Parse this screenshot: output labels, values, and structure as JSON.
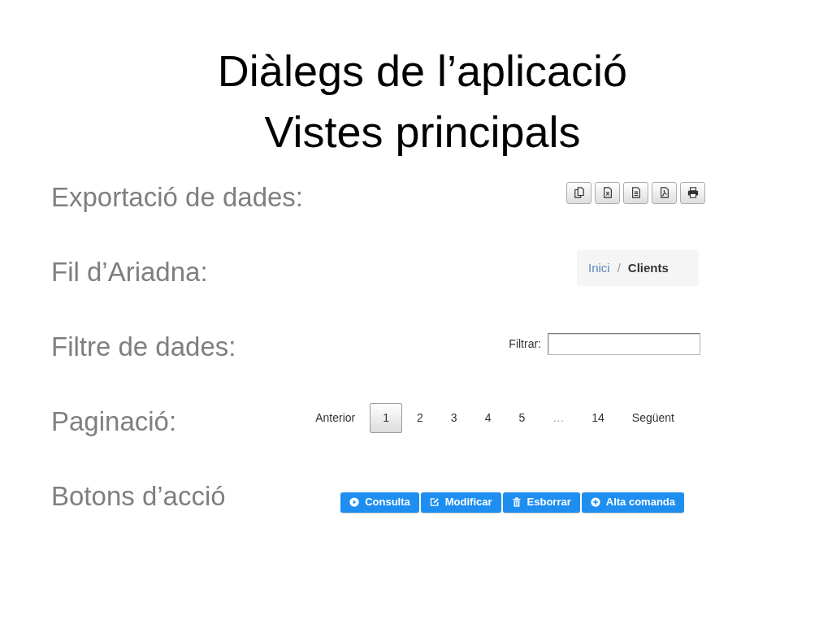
{
  "title_lines": [
    "Diàlegs de l’aplicació",
    "Vistes principals"
  ],
  "rows": [
    {
      "label": "Exportació de dades:",
      "kind": "export"
    },
    {
      "label": "Fil d’Ariadna:",
      "kind": "breadcrumb",
      "breadcrumb": {
        "separator": "/",
        "items": [
          {
            "label": "Inici",
            "selected": false
          },
          {
            "label": "Clients",
            "selected": true
          }
        ]
      }
    },
    {
      "label": "Filtre de dades:",
      "kind": "filter",
      "filter": {
        "label": "Filtrar:"
      }
    },
    {
      "label": "Paginació:",
      "kind": "pagination",
      "pages": [
        {
          "label": "Anterior",
          "kind": "page",
          "selected": false
        },
        {
          "label": "1",
          "kind": "page",
          "selected": true
        },
        {
          "label": "2",
          "kind": "page",
          "selected": false
        },
        {
          "label": "3",
          "kind": "page",
          "selected": false
        },
        {
          "label": "4",
          "kind": "page",
          "selected": false
        },
        {
          "label": "5",
          "kind": "page",
          "selected": false
        },
        {
          "label": "…",
          "kind": "ellipsis"
        },
        {
          "label": "14",
          "kind": "page",
          "selected": false
        },
        {
          "label": "Següent",
          "kind": "page",
          "selected": false
        }
      ]
    },
    {
      "label": "Botons d’acció",
      "kind": "actions",
      "actions": [
        {
          "label": "Consulta"
        },
        {
          "label": "Modificar"
        },
        {
          "label": "Esborrar"
        },
        {
          "label": "Alta comanda"
        }
      ]
    }
  ]
}
